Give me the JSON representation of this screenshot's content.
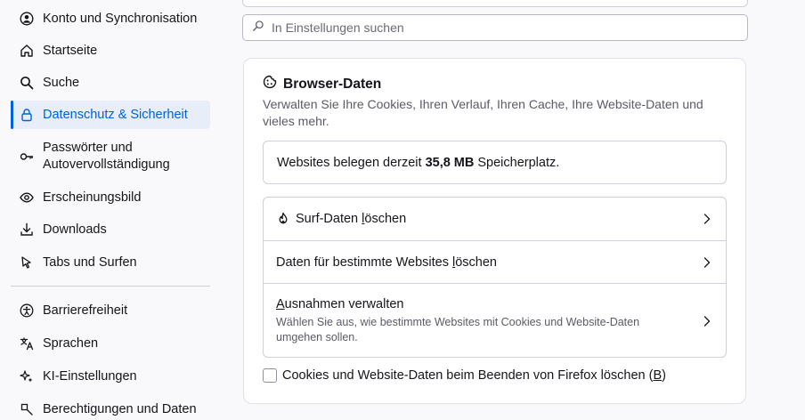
{
  "sidebar": {
    "items": [
      {
        "label": "Konto und Synchronisation",
        "icon": "account-icon"
      },
      {
        "label": "Startseite",
        "icon": "home-icon"
      },
      {
        "label": "Suche",
        "icon": "search-icon"
      },
      {
        "label": "Datenschutz & Sicherheit",
        "icon": "lock-icon",
        "active": true
      },
      {
        "label": "Passwörter und",
        "label2": "Autovervollständigung",
        "icon": "key-icon"
      },
      {
        "label": "Erscheinungsbild",
        "icon": "eye-icon"
      },
      {
        "label": "Downloads",
        "icon": "download-icon"
      },
      {
        "label": "Tabs und Surfen",
        "icon": "tabs-icon"
      },
      {
        "label": "Barrierefreiheit",
        "icon": "accessibility-icon"
      },
      {
        "label": "Sprachen",
        "icon": "language-icon"
      },
      {
        "label": "KI-Einstellungen",
        "icon": "ai-sparkle-icon"
      },
      {
        "label": "Berechtigungen und Daten",
        "icon": "permissions-icon"
      }
    ]
  },
  "search": {
    "placeholder": "In Einstellungen suchen"
  },
  "browser_data": {
    "title": "Browser-Daten",
    "description": "Verwalten Sie Ihre Cookies, Ihren Verlauf, Ihren Cache, Ihre Website-Daten und vieles mehr.",
    "usage_prefix": "Websites belegen derzeit",
    "usage_value": "35,8 MB",
    "usage_suffix": "Speicherplatz.",
    "rows": {
      "clear_surf_pre": "Surf-Daten ",
      "clear_surf_u": "l",
      "clear_surf_post": "öschen",
      "clear_site_pre": "Daten für bestimmte Websites ",
      "clear_site_u": "l",
      "clear_site_post": "öschen",
      "exceptions_u": "A",
      "exceptions_post": "usnahmen verwalten",
      "exceptions_sub": "Wählen Sie aus, wie bestimmte Websites mit Cookies und Website-Daten umgehen sollen."
    },
    "checkbox_pre": "Cookies und Website-Daten beim Beenden von Firefox löschen (",
    "checkbox_u": "B",
    "checkbox_post": ")",
    "checkbox_checked": false
  },
  "colors": {
    "accent": "#0061e0",
    "active_bg": "#e8eef9"
  }
}
